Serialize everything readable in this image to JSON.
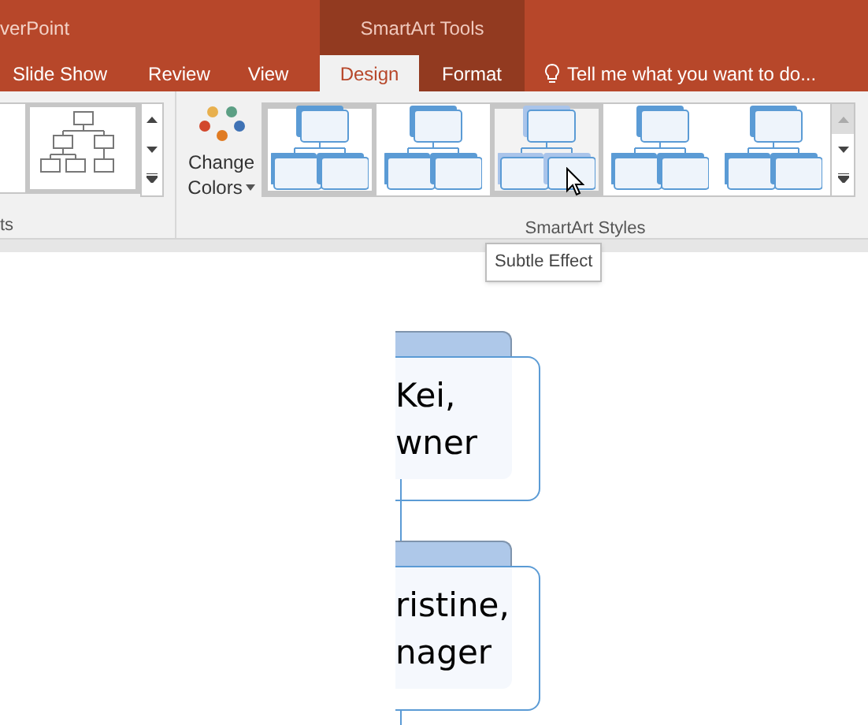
{
  "app_title": "verPoint",
  "contextual_group": "SmartArt Tools",
  "tabs": [
    {
      "label": "Slide Show",
      "selected": false,
      "kind": "normal"
    },
    {
      "label": "Review",
      "selected": false,
      "kind": "normal"
    },
    {
      "label": "View",
      "selected": false,
      "kind": "normal"
    },
    {
      "label": "Design",
      "selected": true,
      "kind": "contextual"
    },
    {
      "label": "Format",
      "selected": false,
      "kind": "contextual"
    }
  ],
  "tell_me": "Tell me what you want to do...",
  "layouts_group": {
    "label": "ts"
  },
  "change_colors": {
    "line_1": "Change",
    "line_2": "Colors"
  },
  "styles_group": {
    "label": "SmartArt Styles",
    "styles": [
      {
        "selected": true,
        "hovered": false
      },
      {
        "selected": false,
        "hovered": false
      },
      {
        "selected": false,
        "hovered": true
      },
      {
        "selected": false,
        "hovered": false
      },
      {
        "selected": false,
        "hovered": false
      }
    ]
  },
  "tooltip": "Subtle Effect",
  "nodes": [
    {
      "lines": [
        "Kei,",
        "wner"
      ]
    },
    {
      "lines": [
        "ristine,",
        "nager"
      ]
    }
  ]
}
